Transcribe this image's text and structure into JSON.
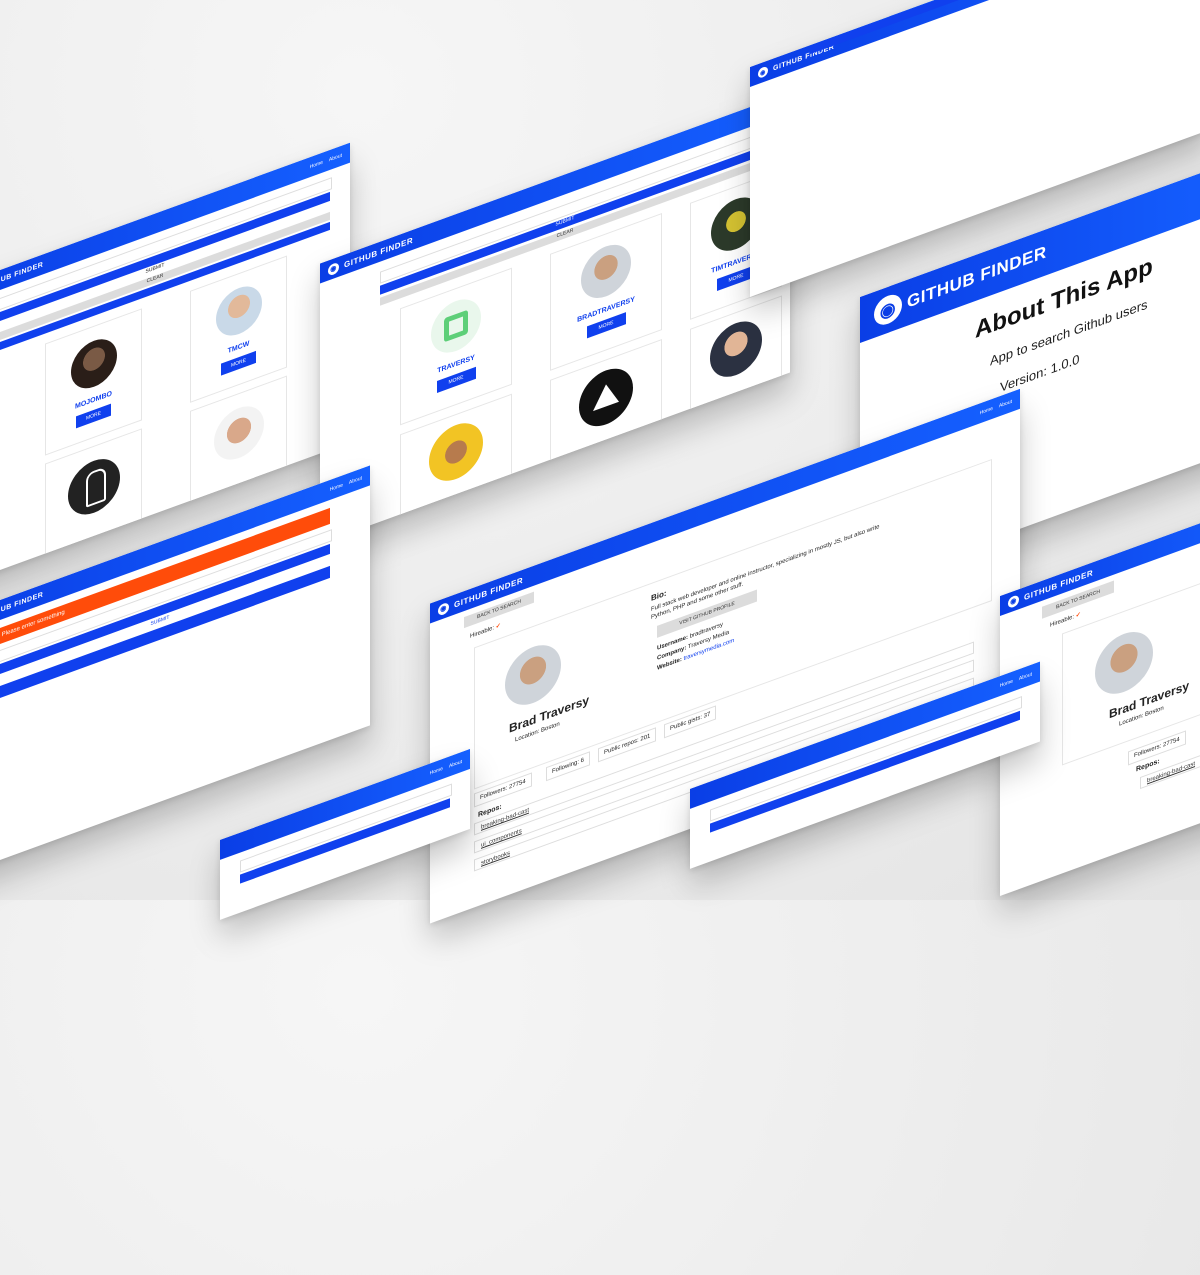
{
  "app": {
    "title": "GITHUB FINDER",
    "logo_icon": "github-octocat-icon"
  },
  "nav": {
    "home": "Home",
    "about": "About"
  },
  "search": {
    "submit": "SUBMIT",
    "clear": "CLEAR",
    "alert": "Please enter something"
  },
  "users": [
    {
      "login": "MOJOMBO",
      "more": "MORE"
    },
    {
      "login": "TMCW",
      "more": "MORE"
    },
    {
      "login": "TRAVERSY",
      "more": "MORE"
    },
    {
      "login": "BRADTRAVERSY",
      "more": "MORE"
    },
    {
      "login": "TIMTRAVERSY",
      "more": "MORE"
    }
  ],
  "about": {
    "heading": "About This App",
    "description": "App to search Github users",
    "version": "Version: 1.0.0"
  },
  "profile": {
    "back": "BACK TO SEARCH",
    "hireable_label": "Hireable:",
    "hireable_icon": "checkmark-icon",
    "name": "Brad Traversy",
    "location": "Location: Boston",
    "bio_label": "Bio:",
    "bio": "Full stack web developer and online instructor, specializing in mostly JS, but also write Python, PHP and some other stuff.",
    "visit": "VISIT GITHUB PROFILE",
    "username_label": "Username:",
    "username": "bradtraversy",
    "company_label": "Company:",
    "company": "Traversy Media",
    "website_label": "Website:",
    "website": "traversymedia.com",
    "followers": "Followers: 27754",
    "following": "Following: 6",
    "repos_count": "Public repos: 201",
    "gists": "Public gists: 37",
    "repos_label": "Repos:",
    "repos": [
      "breaking-bad-cast",
      "ui_components",
      "storybooks"
    ]
  },
  "colors": {
    "primary": "#1040ee",
    "danger": "#ff4c0a",
    "light": "#dcdcdc"
  }
}
